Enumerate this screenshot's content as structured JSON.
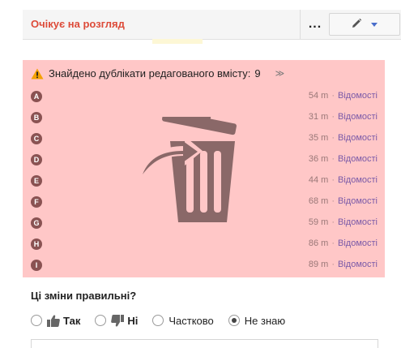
{
  "header": {
    "status": "Очікує на розгляд",
    "more_label": "...",
    "colors": {
      "status": "#dd4b39",
      "accent": "#4a6ecb"
    },
    "icons": {
      "edit": "pencil-icon",
      "dropdown": "chevron-down-icon"
    }
  },
  "duplicates": {
    "title": "Знайдено дублікати редагованого вмісту:",
    "count": "9",
    "expand_glyph": "≫",
    "background": "#ffc7c7",
    "overlay_icon": "trash-icon",
    "rows": [
      {
        "letter": "A",
        "time": "54 m",
        "link": "Відомості"
      },
      {
        "letter": "B",
        "time": "31 m",
        "link": "Відомості"
      },
      {
        "letter": "C",
        "time": "35 m",
        "link": "Відомості"
      },
      {
        "letter": "D",
        "time": "36 m",
        "link": "Відомості"
      },
      {
        "letter": "E",
        "time": "44 m",
        "link": "Відомості"
      },
      {
        "letter": "F",
        "time": "68 m",
        "link": "Відомості"
      },
      {
        "letter": "G",
        "time": "59 m",
        "link": "Відомості"
      },
      {
        "letter": "H",
        "time": "86 m",
        "link": "Відомості"
      },
      {
        "letter": "I",
        "time": "89 m",
        "link": "Відомості"
      }
    ]
  },
  "review": {
    "question": "Ці зміни правильні?",
    "options": {
      "yes": "Так",
      "no": "Ні",
      "partial": "Частково",
      "unknown": "Не знаю"
    },
    "selected": "Не знаю"
  }
}
